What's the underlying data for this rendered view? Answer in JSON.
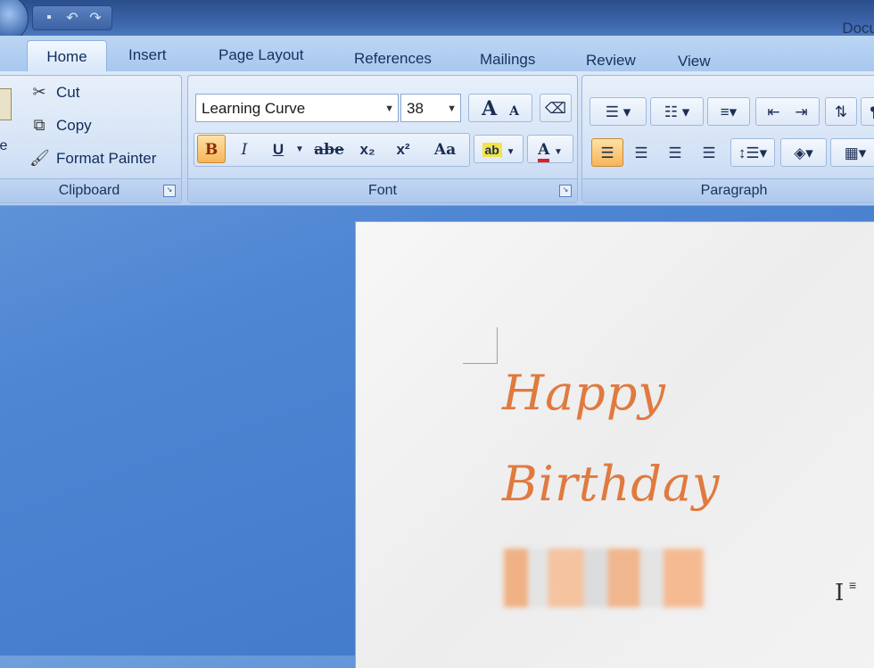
{
  "window": {
    "title": "Docu"
  },
  "qat": {
    "items": [
      "save-icon",
      "undo-icon",
      "redo-icon"
    ]
  },
  "tabs": [
    {
      "id": "home",
      "label": "Home",
      "active": true
    },
    {
      "id": "insert",
      "label": "Insert"
    },
    {
      "id": "page-layout",
      "label": "Page Layout"
    },
    {
      "id": "references",
      "label": "References"
    },
    {
      "id": "mailings",
      "label": "Mailings"
    },
    {
      "id": "review",
      "label": "Review"
    },
    {
      "id": "view",
      "label": "View"
    }
  ],
  "clipboard": {
    "paste_label": "te",
    "cut": "Cut",
    "copy": "Copy",
    "format_painter": "Format Painter",
    "group_label": "Clipboard"
  },
  "font": {
    "name": "Learning Curve",
    "size": "38",
    "grow": "A",
    "shrink": "A",
    "bold": "B",
    "italic": "I",
    "underline": "U",
    "strike": "abe",
    "subscript": "x₂",
    "superscript": "x²",
    "change_case": "Aa",
    "font_color": "A",
    "group_label": "Font"
  },
  "paragraph": {
    "group_label": "Paragraph",
    "pilcrow": "¶"
  },
  "document": {
    "line1": "Happy",
    "line2": "Birthday",
    "accent_color": "#e07a3f"
  }
}
